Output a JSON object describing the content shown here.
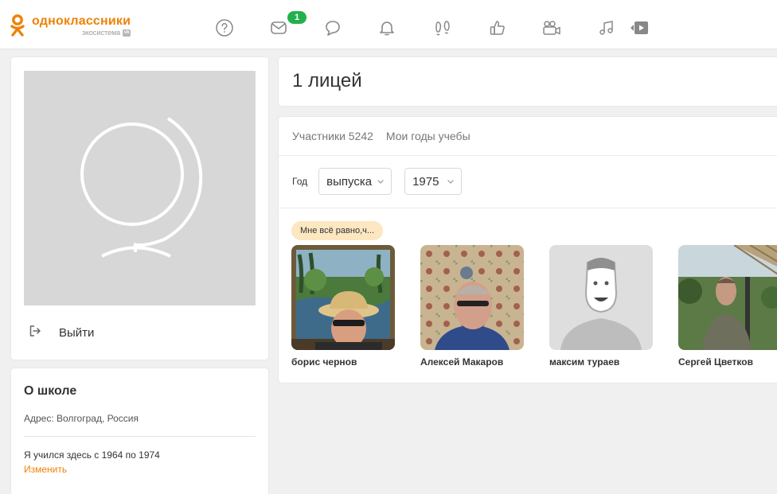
{
  "header": {
    "brand_name": "одноклассники",
    "brand_sub": "экосистема",
    "brand_color": "#ee8208",
    "nav_icons": [
      "help-icon",
      "messages-icon",
      "discussions-icon",
      "notifications-icon",
      "guests-icon",
      "marks-icon",
      "video-icon",
      "music-icon",
      "video-play-icon"
    ],
    "messages_badge": "1",
    "badge_color": "#22b14c"
  },
  "sidebar": {
    "logout_label": "Выйти",
    "about": {
      "title": "О школе",
      "address": "Адрес: Волгоград, Россия",
      "years": "Я учился здесь с 1964 по 1974",
      "edit_label": "Изменить"
    }
  },
  "main": {
    "title": "1 лицей",
    "tabs": [
      {
        "label": "Участники 5242"
      },
      {
        "label": "Мои годы учебы"
      }
    ],
    "filter": {
      "label": "Год",
      "type_value": "выпуска",
      "year_value": "1975"
    },
    "status_text": "Мне всё равно,ч...",
    "members": [
      {
        "name": "борис чернов"
      },
      {
        "name": "Алексей Макаров"
      },
      {
        "name": "максим тураев"
      },
      {
        "name": "Сергей Цветков"
      }
    ]
  }
}
